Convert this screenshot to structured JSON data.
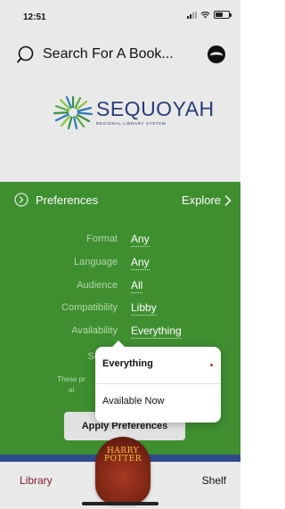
{
  "status_bar": {
    "time": "12:51"
  },
  "search": {
    "placeholder": "Search For A Book..."
  },
  "logo": {
    "name": "SEQUOYAH",
    "subtitle": "REGIONAL LIBRARY SYSTEM"
  },
  "preferences": {
    "title": "Preferences",
    "explore_label": "Explore",
    "rows": [
      {
        "label": "Format",
        "value": "Any"
      },
      {
        "label": "Language",
        "value": "Any"
      },
      {
        "label": "Audience",
        "value": "All"
      },
      {
        "label": "Compatibility",
        "value": "Libby"
      },
      {
        "label": "Availability",
        "value": "Everything"
      }
    ],
    "partial_label": "So",
    "note_fragments": [
      "These pr",
      "ai"
    ],
    "apply_label": "Apply Preferences"
  },
  "dropdown": {
    "options": [
      {
        "label": "Everything",
        "selected": true
      },
      {
        "label": "Available Now",
        "selected": false
      }
    ]
  },
  "book": {
    "title_lines": [
      "HARRY",
      "POTTER"
    ]
  },
  "tabbar": {
    "library_label": "Library",
    "shelf_label": "Shelf"
  },
  "colors": {
    "panel_green": "#3f8f31",
    "header_gray": "#e9e9e9",
    "logo_blue": "#2a3c7a",
    "library_accent": "#7a1c2a",
    "selected_dot": "#c0303a"
  }
}
